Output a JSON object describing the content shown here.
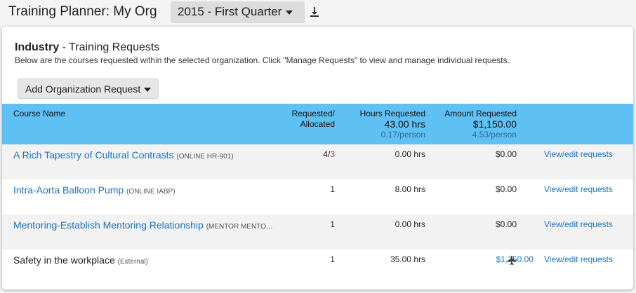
{
  "header": {
    "app_title": "Training Planner: My Org",
    "period_selected": "2015 - First Quarter",
    "download_icon": "download-icon"
  },
  "panel": {
    "org_name": "Industry",
    "section_title": " - Training Requests",
    "description": "Below are the courses requested within the selected organization. Click \"Manage Requests\" to view and manage individual requests.",
    "add_button_label": "Add Organization Request"
  },
  "table": {
    "headers": {
      "course": "Course Name",
      "requested_line1": "Requested/",
      "requested_line2": "Allocated",
      "hours": "Hours Requested",
      "hours_total": "43.00 hrs",
      "hours_per": "0.17/person",
      "amount": "Amount Requested",
      "amount_total": "$1,150.00",
      "amount_per": "4.53/person"
    },
    "rows": [
      {
        "course": "A Rich Tapestry of Cultural Contrasts",
        "code": "(ONLINE HR-901)",
        "requested": "4/",
        "allocated": "3",
        "hours": "0.00 hrs",
        "amount": "$0.00",
        "action": "View/edit requests"
      },
      {
        "course": "Intra-Aorta Balloon Pump",
        "code": "(ONLINE IABP)",
        "requested": "1",
        "allocated": "",
        "hours": "8.00 hrs",
        "amount": "$0.00",
        "action": "View/edit requests"
      },
      {
        "course": "Mentoring-Establish Mentoring Relationship",
        "code": "(MENTOR MENTO…",
        "requested": "1",
        "allocated": "",
        "hours": "0.00 hrs",
        "amount": "$0.00",
        "action": "View/edit requests"
      },
      {
        "course": "Safety in the workplace",
        "code": "(External)",
        "requested": "1",
        "allocated": "",
        "hours": "35.00 hrs",
        "amount": "$1,150.00",
        "amount_icon": "airplane-icon",
        "action": "View/edit requests"
      }
    ]
  },
  "colors": {
    "header_bar": "#5ec0f3",
    "link": "#1f73b7",
    "allocated_warning": "#c0392b"
  }
}
